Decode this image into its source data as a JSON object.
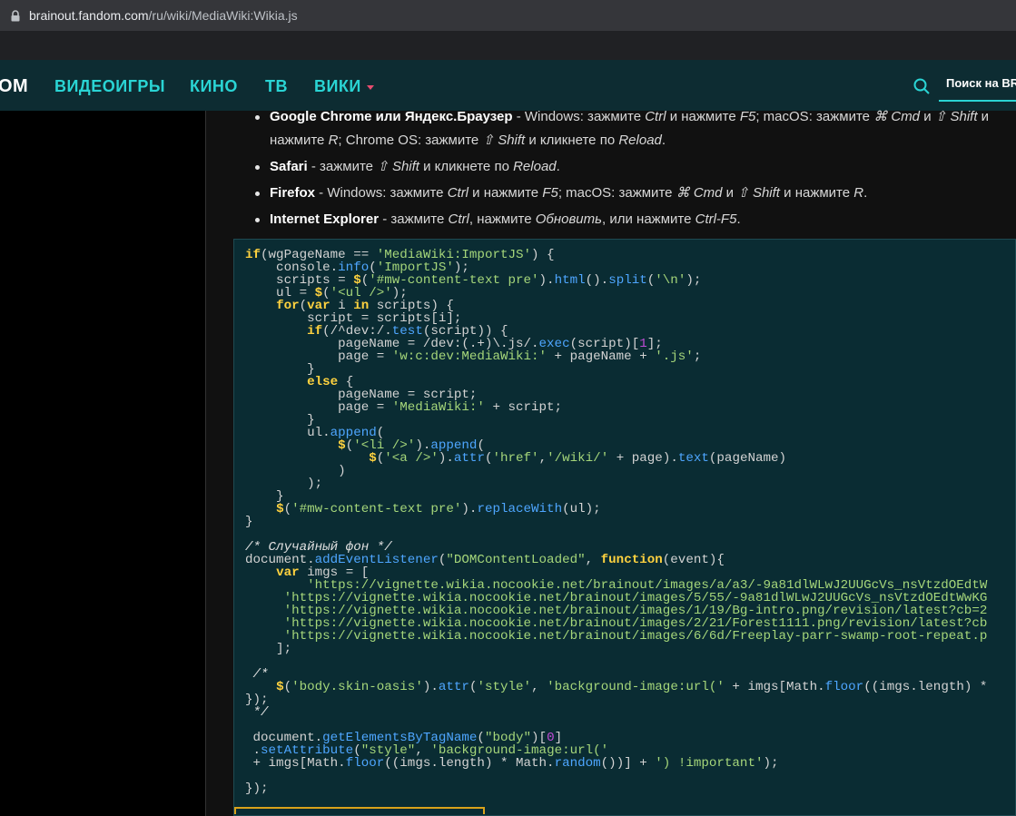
{
  "browser": {
    "url_host": "brainout.fandom.com",
    "url_path": "/ru/wiki/MediaWiki:Wikia.js",
    "lock_icon": "lock-icon"
  },
  "nav": {
    "logo": "OM",
    "items": [
      "ВИДЕОИГРЫ",
      "КИНО",
      "ТВ",
      "ВИКИ"
    ],
    "search_placeholder": "Поиск на BR",
    "accent": "#2ad4d4",
    "caret_color": "#e84d6f"
  },
  "instructions": [
    {
      "browser": "Google Chrome или Яндекс.Браузер",
      "text_parts": [
        " - Windows: зажмите ",
        "Ctrl",
        " и нажмите ",
        "F5",
        "; macOS: зажмите ",
        "⌘ Cmd",
        " и ",
        "⇧ Shift",
        " и нажмите ",
        "R",
        "; Chrome OS: зажмите ",
        "⇧ Shift",
        " и кликнете по ",
        "Reload",
        "."
      ]
    },
    {
      "browser": "Safari",
      "text_parts": [
        " - зажмите ",
        "⇧ Shift",
        " и кликнете по ",
        "Reload",
        "."
      ]
    },
    {
      "browser": "Firefox",
      "text_parts": [
        " - Windows: зажмите ",
        "Ctrl",
        " и нажмите ",
        "F5",
        "; macOS: зажмите ",
        "⌘ Cmd",
        " и ",
        "⇧ Shift",
        " и нажмите ",
        "R",
        "."
      ]
    },
    {
      "browser": "Internet Explorer",
      "text_parts": [
        " - зажмите ",
        "Ctrl",
        ", нажмите ",
        "Обновить",
        ", или нажмите ",
        "Ctrl-F5",
        "."
      ]
    }
  ],
  "code_lines": [
    "if(wgPageName == 'MediaWiki:ImportJS') {",
    "    console.info('ImportJS');",
    "    scripts = $('#mw-content-text pre').html().split('\\n');",
    "    ul = $('<ul />');",
    "    for(var i in scripts) {",
    "        script = scripts[i];",
    "        if(/^dev:/.test(script)) {",
    "            pageName = /dev:(.+)\\.js/.exec(script)[1];",
    "            page = 'w:c:dev:MediaWiki:' + pageName + '.js';",
    "        }",
    "        else {",
    "            pageName = script;",
    "            page = 'MediaWiki:' + script;",
    "        }",
    "        ul.append(",
    "            $('<li />').append(",
    "                $('<a />').attr('href','/wiki/' + page).text(pageName)",
    "            )",
    "        );",
    "    }",
    "    $('#mw-content-text pre').replaceWith(ul);",
    "}",
    "",
    "/* Случайный фон */",
    "document.addEventListener(\"DOMContentLoaded\", function(event){",
    "    var imgs = [",
    "        'https://vignette.wikia.nocookie.net/brainout/images/a/a3/-9a81dlWLwJ2UUGcVs_nsVtzdOEdtW",
    "     'https://vignette.wikia.nocookie.net/brainout/images/5/55/-9a81dlWLwJ2UUGcVs_nsVtzdOEdtWwKG",
    "     'https://vignette.wikia.nocookie.net/brainout/images/1/19/Bg-intro.png/revision/latest?cb=2",
    "     'https://vignette.wikia.nocookie.net/brainout/images/2/21/Forest1111.png/revision/latest?cb",
    "     'https://vignette.wikia.nocookie.net/brainout/images/6/6d/Freeplay-parr-swamp-root-repeat.p",
    "    ];",
    "",
    " /*",
    "    $('body.skin-oasis').attr('style', 'background-image:url(' + imgs[Math.floor((imgs.length) *",
    "});",
    " */",
    "",
    " document.getElementsByTagName(\"body\")[0]",
    " .setAttribute(\"style\", 'background-image:url('",
    " + imgs[Math.floor((imgs.length) * Math.random())] + ') !important');",
    "",
    "});"
  ],
  "colors": {
    "code_bg": "#0a2c33",
    "keyword": "#ffd23f",
    "string": "#a5d67a",
    "function": "#4ea6ff",
    "number": "#c04cd6"
  }
}
